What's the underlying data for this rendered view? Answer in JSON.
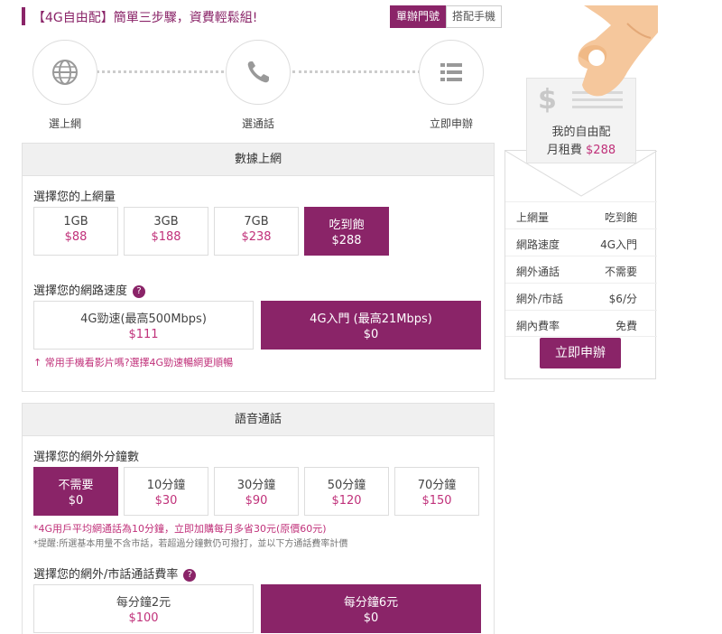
{
  "header": {
    "title_bracket": "【4G自由配】",
    "title_rest": "簡單三步驟，資費輕鬆組!",
    "tabs": [
      {
        "label": "單辦門號",
        "active": true
      },
      {
        "label": "搭配手機",
        "active": false
      }
    ]
  },
  "steps": [
    {
      "label": "選上網",
      "icon": "globe-icon"
    },
    {
      "label": "選通話",
      "icon": "phone-icon"
    },
    {
      "label": "立即申辦",
      "icon": "list-icon"
    }
  ],
  "data_panel": {
    "title": "數據上網",
    "volume_label": "選擇您的上網量",
    "volume_options": [
      {
        "name": "1GB",
        "price": "$88",
        "selected": false
      },
      {
        "name": "3GB",
        "price": "$188",
        "selected": false
      },
      {
        "name": "7GB",
        "price": "$238",
        "selected": false
      },
      {
        "name": "吃到飽",
        "price": "$288",
        "selected": true
      }
    ],
    "speed_label": "選擇您的網路速度",
    "help": "?",
    "speed_options": [
      {
        "name": "4G勁速(最高500Mbps)",
        "price": "$111",
        "selected": false
      },
      {
        "name": "4G入門 (最高21Mbps)",
        "price": "$0",
        "selected": true
      }
    ],
    "speed_note": "↑ 常用手機看影片嗎?選擇4G勁速暢網更順暢"
  },
  "voice_panel": {
    "title": "語音通話",
    "minutes_label": "選擇您的網外分鐘數",
    "minutes_options": [
      {
        "name": "不需要",
        "price": "$0",
        "selected": true
      },
      {
        "name": "10分鐘",
        "price": "$30",
        "selected": false
      },
      {
        "name": "30分鐘",
        "price": "$90",
        "selected": false
      },
      {
        "name": "50分鐘",
        "price": "$120",
        "selected": false
      },
      {
        "name": "70分鐘",
        "price": "$150",
        "selected": false
      }
    ],
    "note1": "*4G用戶平均網通話為10分鐘，立即加購每月多省30元(原價60元)",
    "note2": "*提醒:所選基本用量不含市話，若超過分鐘數仍可撥打，並以下方通話費率計價",
    "rate_label": "選擇您的網外/市話通話費率",
    "help": "?",
    "rate_options": [
      {
        "name": "每分鐘2元",
        "price": "$100",
        "selected": false
      },
      {
        "name": "每分鐘6元",
        "price": "$0",
        "selected": true
      }
    ]
  },
  "summary": {
    "card_line1": "我的自由配",
    "card_line2_label": "月租費",
    "card_price": "$288",
    "dollar_sign": "$",
    "rows": [
      {
        "key": "上網量",
        "value": "吃到飽"
      },
      {
        "key": "網路速度",
        "value": "4G入門"
      },
      {
        "key": "網外通話",
        "value": "不需要"
      },
      {
        "key": "網外/市話",
        "value": "$6/分"
      },
      {
        "key": "網內費率",
        "value": "免費"
      }
    ],
    "apply_label": "立即申辦"
  },
  "colors": {
    "accent": "#8a2468",
    "price": "#c0317a"
  }
}
